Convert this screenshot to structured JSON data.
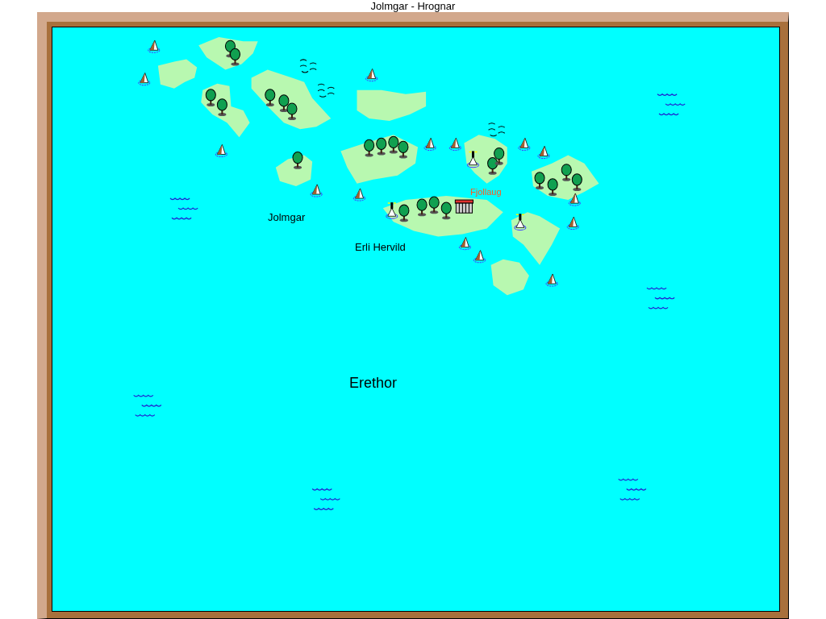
{
  "window": {
    "title": "Jolmgar - Hrognar"
  },
  "map": {
    "labels": [
      {
        "text": "Fjollaug",
        "kind": "town"
      },
      {
        "text": "Jolmgar",
        "kind": "region"
      },
      {
        "text": "Erli Hervild",
        "kind": "region"
      },
      {
        "text": "Erethor",
        "kind": "sea"
      }
    ]
  }
}
